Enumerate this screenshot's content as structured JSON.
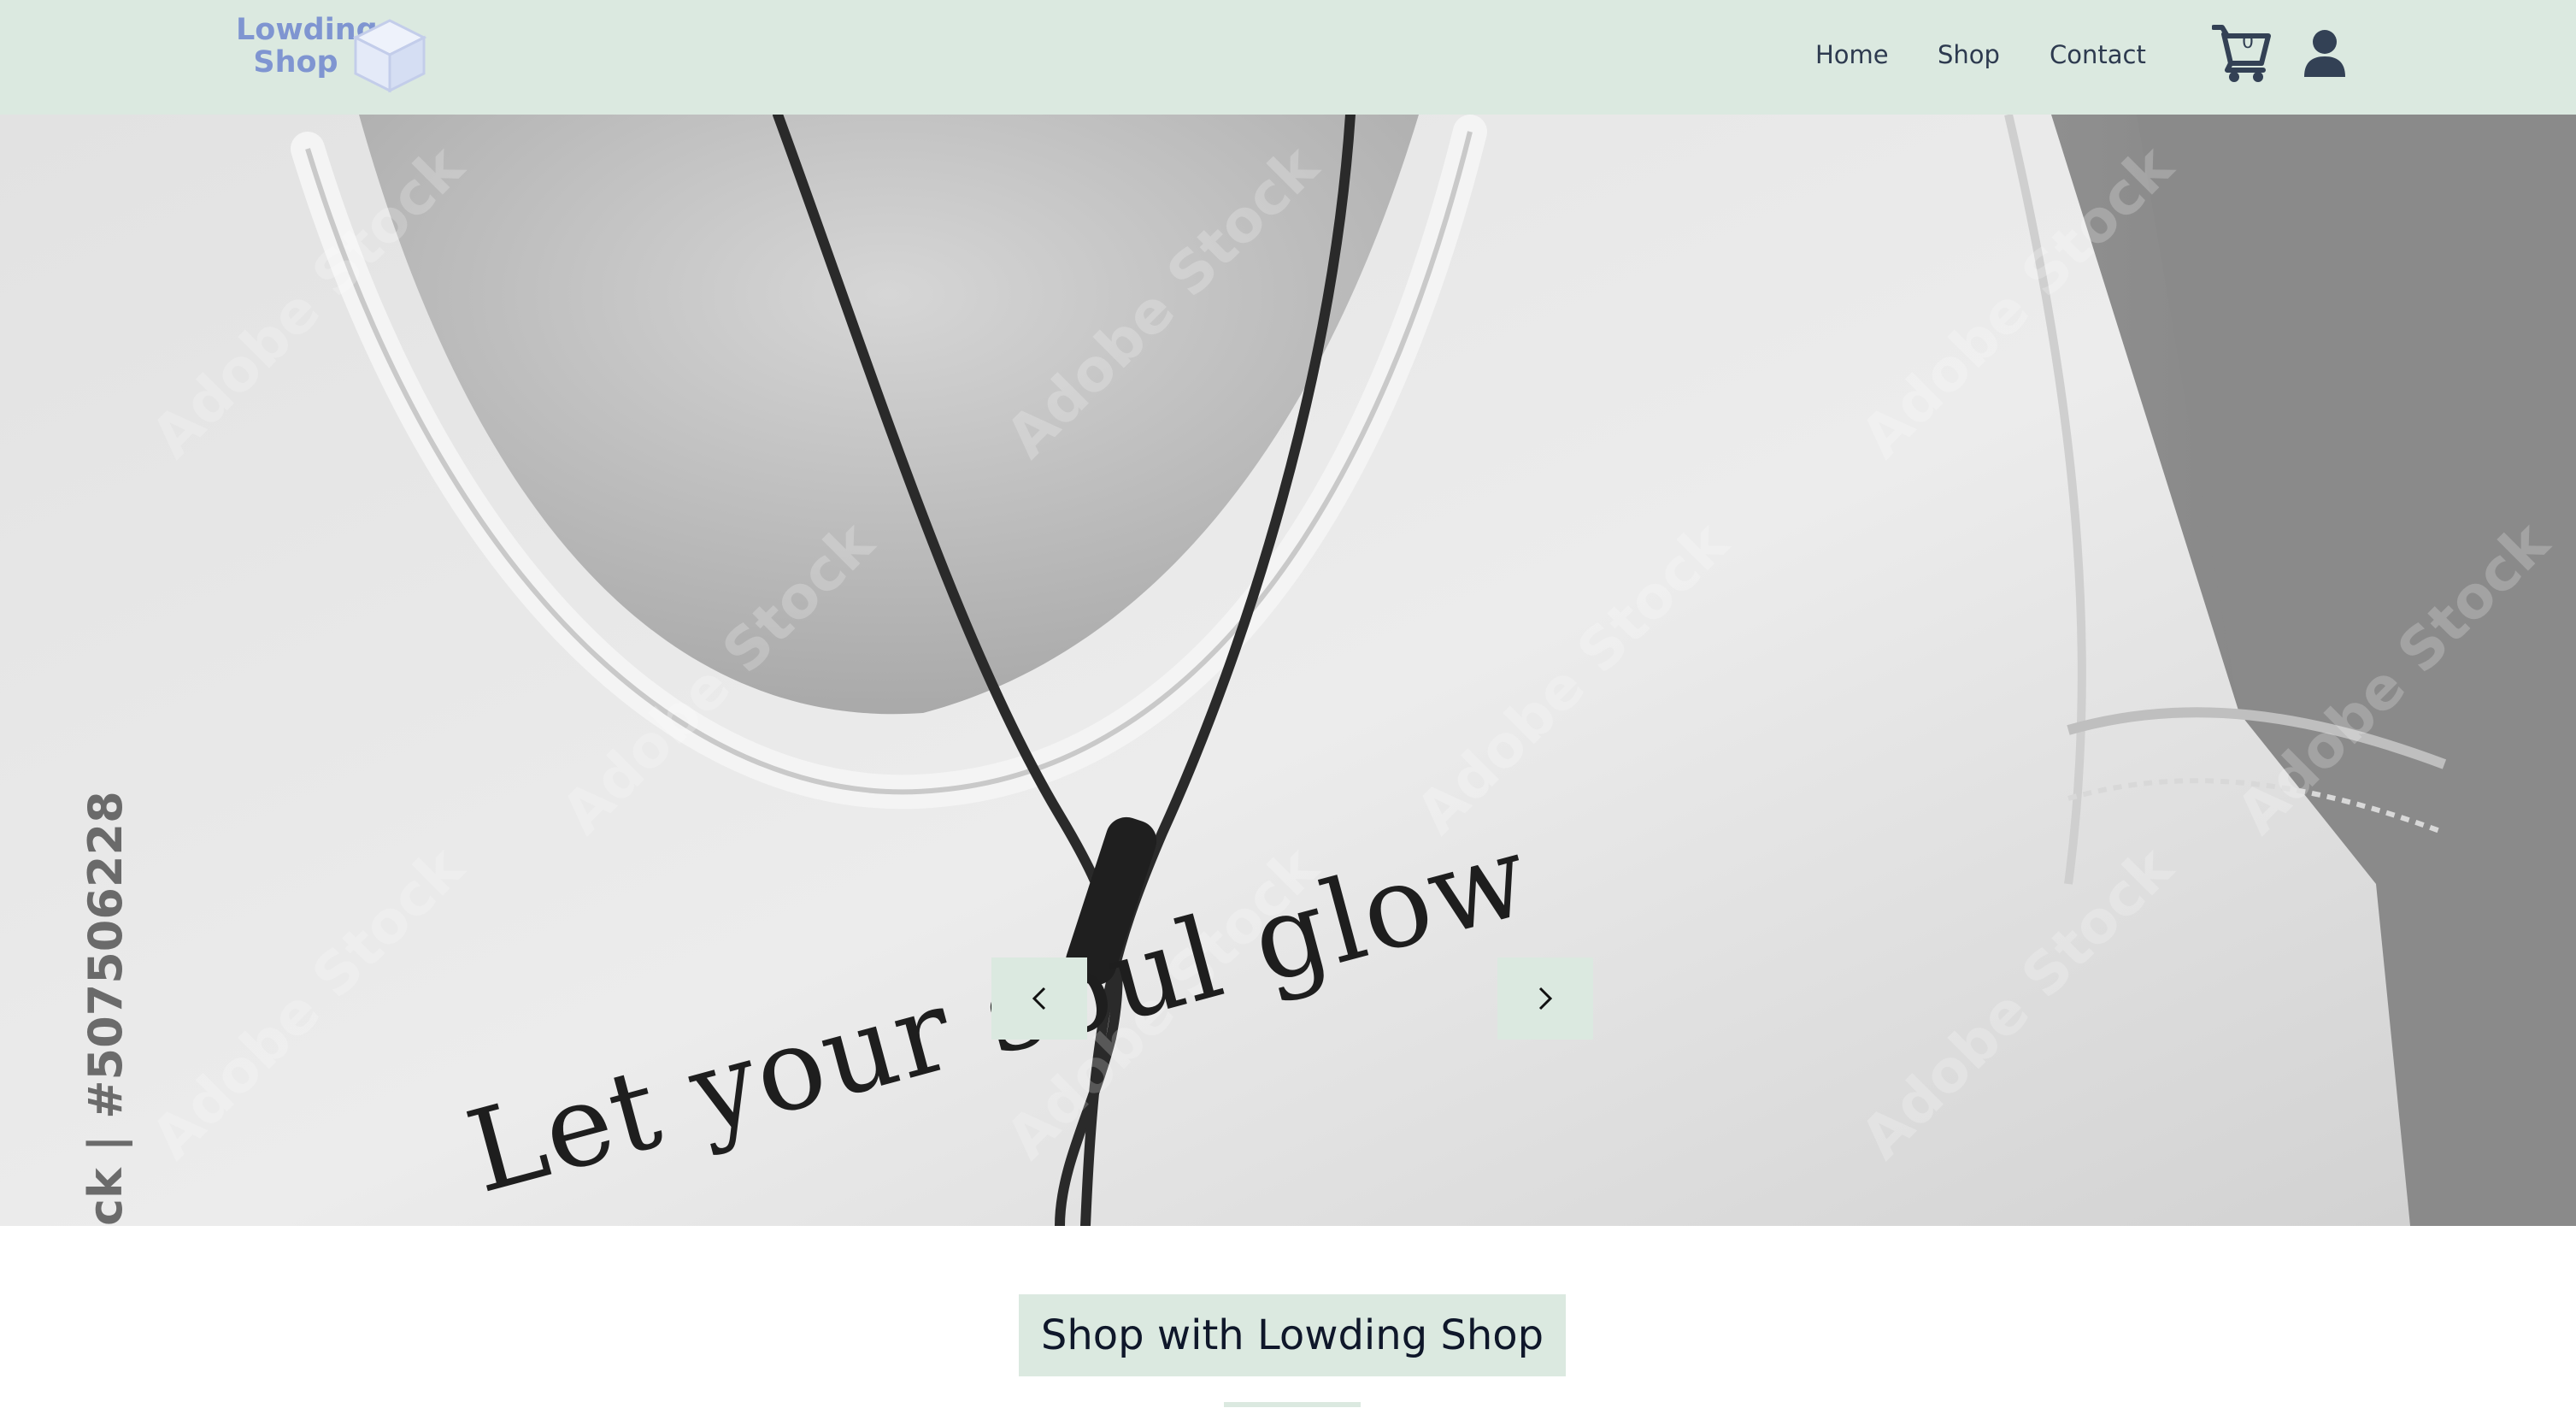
{
  "logo": {
    "line1": "Lowding",
    "line2": "Shop",
    "box_icon": "box-icon",
    "color": "#7f95d1"
  },
  "nav": {
    "home": "Home",
    "shop": "Shop",
    "contact": "Contact"
  },
  "cart": {
    "count": "0",
    "icon": "shopping-cart-icon"
  },
  "user": {
    "icon": "user-icon"
  },
  "hero": {
    "print_text": "Let your soul glow",
    "stock_id": "ck | #507506228",
    "watermark": "Adobe Stock",
    "prev_icon": "chevron-left-icon",
    "next_icon": "chevron-right-icon"
  },
  "cta": {
    "label": "Shop with Lowding Shop"
  },
  "colors": {
    "header_bg": "#dbe9e0",
    "nav_text": "#2d3a4f",
    "accent": "#dbe9e0"
  }
}
